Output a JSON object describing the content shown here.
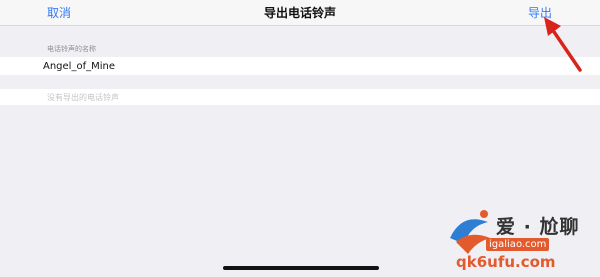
{
  "nav": {
    "cancel_label": "取消",
    "title": "导出电话铃声",
    "export_label": "导出"
  },
  "ringtone_name": {
    "label": "电话铃声的名称",
    "value": "Angel_of_Mine"
  },
  "empty_message": "没有导出的电话铃声",
  "watermark": {
    "line1": "爱 · 尬聊",
    "line2": "igaliao.com",
    "line3": "qk6ufu.com"
  },
  "colors": {
    "accent": "#3478f6",
    "annotation_arrow": "#d9241c",
    "background": "#efeff4"
  }
}
